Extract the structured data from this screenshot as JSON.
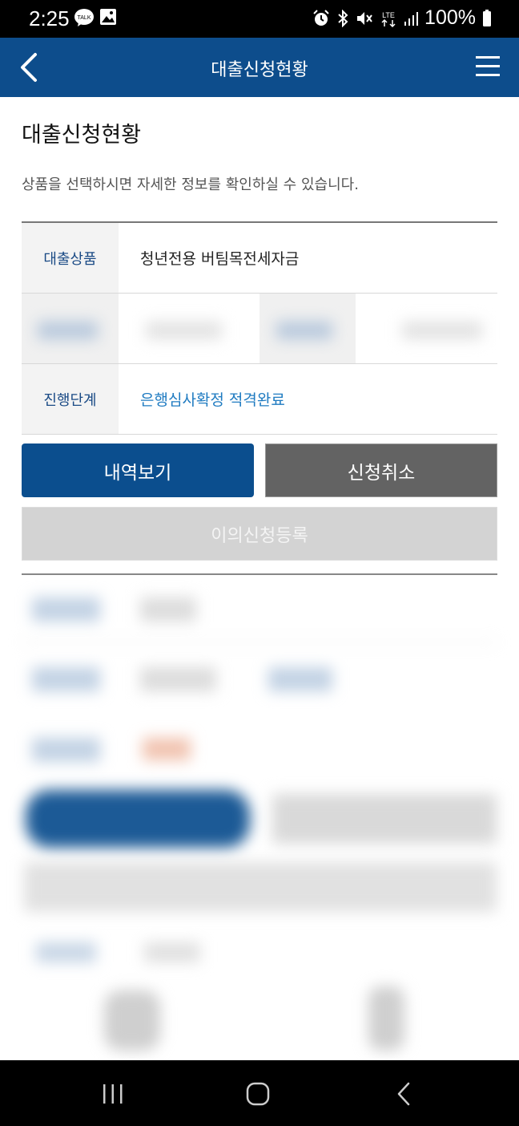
{
  "status_bar": {
    "time": "2:25",
    "battery": "100%",
    "network": "LTE",
    "left_icons": [
      "kakaotalk-icon",
      "image-icon"
    ],
    "right_icons": [
      "alarm-icon",
      "bluetooth-icon",
      "mute-icon",
      "lte-icon",
      "signal-icon",
      "battery-icon"
    ]
  },
  "header": {
    "title": "대출신청현황",
    "back_icon": "chevron-left-icon",
    "menu_icon": "hamburger-menu-icon",
    "background": "#0d4d8c"
  },
  "main": {
    "heading": "대출신청현황",
    "description": "상품을 선택하시면 자세한 정보를 확인하실 수 있습니다.",
    "rows": [
      {
        "label": "대출상품",
        "value": "청년전용 버팀목전세자금"
      },
      {
        "label": "진행단계",
        "value": "은행심사확정 적격완료"
      }
    ],
    "buttons": {
      "history": "내역보기",
      "cancel": "신청취소",
      "objection": "이의신청등록"
    }
  },
  "colors": {
    "primary": "#0b4e8e",
    "cancel": "#636363",
    "disabled": "#d3d3d3",
    "status_blue": "#1f7bc1",
    "label_blue": "#1a4a85"
  },
  "nav_bar": {
    "icons": [
      "recent-apps-icon",
      "home-icon",
      "back-icon"
    ]
  }
}
